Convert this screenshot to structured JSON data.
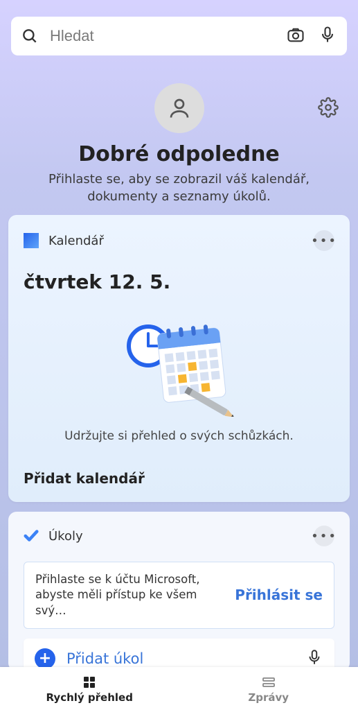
{
  "search": {
    "placeholder": "Hledat"
  },
  "greeting": {
    "title": "Dobré odpoledne",
    "subtitle": "Přihlaste se, aby se zobrazil váš kalendář, dokumenty a seznamy úkolů."
  },
  "calendar": {
    "title": "Kalendář",
    "date": "čtvrtek 12. 5.",
    "tagline": "Udržujte si přehled o svých schůzkách.",
    "add_label": "Přidat kalendář"
  },
  "tasks": {
    "title": "Úkoly",
    "signin_text": "Přihlaste se k účtu Microsoft, abyste měli přístup ke všem svý…",
    "signin_button": "Přihlásit se",
    "add_label": "Přidat úkol"
  },
  "nav": {
    "glance": "Rychlý přehled",
    "news": "Zprávy"
  }
}
